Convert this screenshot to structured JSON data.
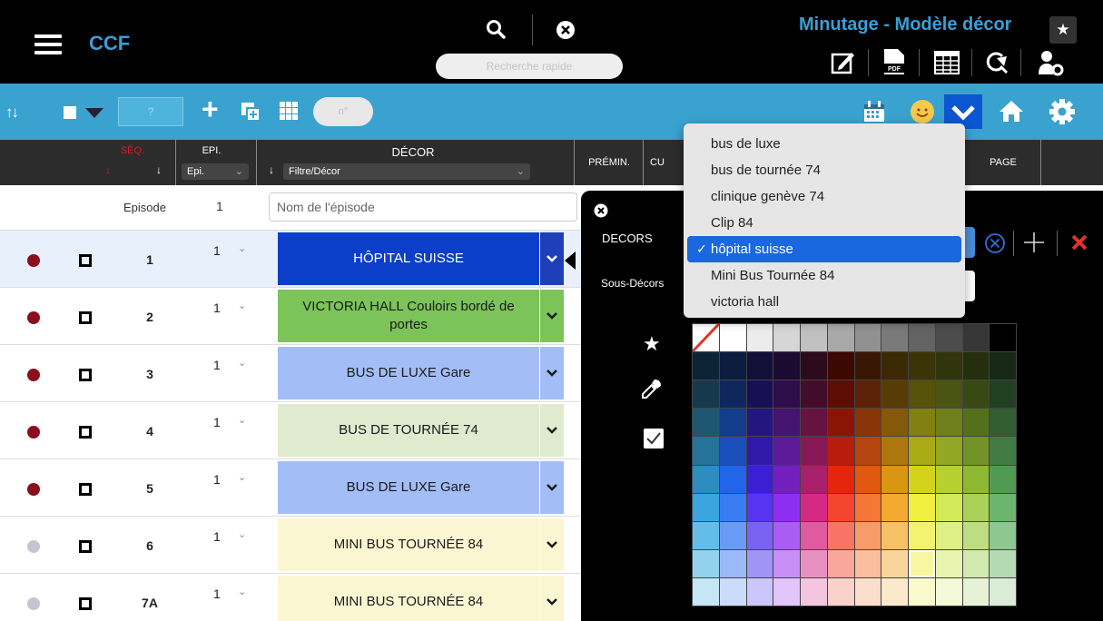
{
  "header": {
    "app_name": "CCF",
    "title": "Minutage - Modèle décor",
    "search_placeholder": "Recherche rapide",
    "fav_icon": "star-icon"
  },
  "toolbar": {
    "input_placeholder": "?",
    "number_placeholder": "n°"
  },
  "columns": {
    "seq": "SÉQ.",
    "epi": "EPI.",
    "epi_select": "Epi.",
    "decor": "DÉCOR",
    "decor_filter": "Filtre/Décor",
    "premin": "PRÉMIN.",
    "cu": "CU",
    "page": "PAGE"
  },
  "episode": {
    "label": "Episode",
    "number": "1",
    "name_placeholder": "Nom de l'épisode"
  },
  "rows": [
    {
      "status_color": "#8b0f1e",
      "seq": "1",
      "epi": "1",
      "decor": "HÔPITAL SUISSE",
      "decor_bg": "#0b3fc9",
      "decor_fg": "#ffffff",
      "dd_bg": "#1e3fb8",
      "dd_fg": "#ffffff",
      "selected": true
    },
    {
      "status_color": "#8b0f1e",
      "seq": "2",
      "epi": "1",
      "decor": "VICTORIA HALL Couloirs bordé de portes",
      "decor_bg": "#7cc35a",
      "decor_fg": "#1a1a1a",
      "dd_bg": "#7cc35a",
      "dd_fg": "#1a1a1a",
      "selected": false
    },
    {
      "status_color": "#8b0f1e",
      "seq": "3",
      "epi": "1",
      "decor": "BUS DE LUXE Gare",
      "decor_bg": "#a3bdf6",
      "decor_fg": "#1a1a1a",
      "dd_bg": "#a3bdf6",
      "dd_fg": "#1a1a1a",
      "selected": false
    },
    {
      "status_color": "#8b0f1e",
      "seq": "4",
      "epi": "1",
      "decor": "BUS DE TOURNÉE 74",
      "decor_bg": "#dfeacf",
      "decor_fg": "#1a1a1a",
      "dd_bg": "#dfeacf",
      "dd_fg": "#1a1a1a",
      "selected": false
    },
    {
      "status_color": "#8b0f1e",
      "seq": "5",
      "epi": "1",
      "decor": "BUS DE LUXE Gare",
      "decor_bg": "#a3bdf6",
      "decor_fg": "#1a1a1a",
      "dd_bg": "#a3bdf6",
      "dd_fg": "#1a1a1a",
      "selected": false
    },
    {
      "status_color": "#c3c6d2",
      "seq": "6",
      "epi": "1",
      "decor": "MINI BUS TOURNÉE 84",
      "decor_bg": "#fbf6d2",
      "decor_fg": "#1a1a1a",
      "dd_bg": "#fbf6d2",
      "dd_fg": "#1a1a1a",
      "selected": false
    },
    {
      "status_color": "#c3c6d2",
      "seq": "7A",
      "epi": "1",
      "decor": "MINI BUS TOURNÉE 84",
      "decor_bg": "#fbf6d2",
      "decor_fg": "#1a1a1a",
      "dd_bg": "#fbf6d2",
      "dd_fg": "#1a1a1a",
      "selected": false
    }
  ],
  "panel": {
    "decors_label": "DECORS",
    "sous_decors_label": "Sous-Décors"
  },
  "dropdown": {
    "options": [
      "bus de luxe",
      "bus de tournée 74",
      "clinique genève 74",
      "Clip 84",
      "hôpital suisse",
      "Mini Bus Tournée 84",
      "victoria hall"
    ],
    "selected": "hôpital suisse",
    "check_mark": "✓"
  },
  "palette": {
    "columns": 12,
    "selected_index": 104,
    "colors": [
      "none",
      "#ffffff",
      "#ececec",
      "#d6d6d6",
      "#c0c0c0",
      "#a8a8a8",
      "#919191",
      "#7a7a7a",
      "#636363",
      "#4c4c4c",
      "#363636",
      "#000000",
      "#0d2436",
      "#0b1c3f",
      "#120f38",
      "#1b0b31",
      "#2d0a1c",
      "#3d0702",
      "#3a1704",
      "#3b2904",
      "#3a3506",
      "#30350c",
      "#252f0d",
      "#162816",
      "#17394d",
      "#0e285e",
      "#190f55",
      "#2e0d4b",
      "#420d2b",
      "#5c0e04",
      "#5b2207",
      "#573c06",
      "#56520a",
      "#4a5413",
      "#394913",
      "#213f22",
      "#1f5773",
      "#133c8c",
      "#251580",
      "#451471",
      "#651341",
      "#8a1507",
      "#88350a",
      "#845a0a",
      "#818010",
      "#6f7f1c",
      "#55701d",
      "#325d32",
      "#25729a",
      "#1a4fbb",
      "#3018ab",
      "#5b1a97",
      "#861956",
      "#b81c0b",
      "#b4450f",
      "#ae780f",
      "#aaa916",
      "#93a727",
      "#719327",
      "#427b43",
      "#2d8cc0",
      "#2264ea",
      "#3b1fd3",
      "#721fbd",
      "#a8206b",
      "#e5260d",
      "#e1580f",
      "#d99610",
      "#d4d21b",
      "#b6d032",
      "#8db832",
      "#529954",
      "#3aa6df",
      "#3a7df2",
      "#5634f2",
      "#8c2ff0",
      "#d42a86",
      "#f54531",
      "#f57636",
      "#f3aa31",
      "#f0ee40",
      "#d2ea58",
      "#a9d158",
      "#6db46f",
      "#64bde8",
      "#6a9bf4",
      "#7a63f4",
      "#a95df3",
      "#e05aa0",
      "#f77565",
      "#f89a6a",
      "#f6c165",
      "#f4f270",
      "#deef83",
      "#bddd83",
      "#8fc790",
      "#93d2ef",
      "#9ab9f7",
      "#a095f7",
      "#c68ff6",
      "#e890c0",
      "#f9a69b",
      "#fbbe9e",
      "#f8d69b",
      "#f8f6a0",
      "#e8f4af",
      "#d1e8af",
      "#b4dab4",
      "#c6e6f6",
      "#cbdbfb",
      "#cbc6fb",
      "#e2c5fa",
      "#f3c5de",
      "#fbd2cb",
      "#fcdecc",
      "#fbe9cb",
      "#fbfacd",
      "#f3f9d6",
      "#e6f2d6",
      "#d8ecd8"
    ]
  }
}
